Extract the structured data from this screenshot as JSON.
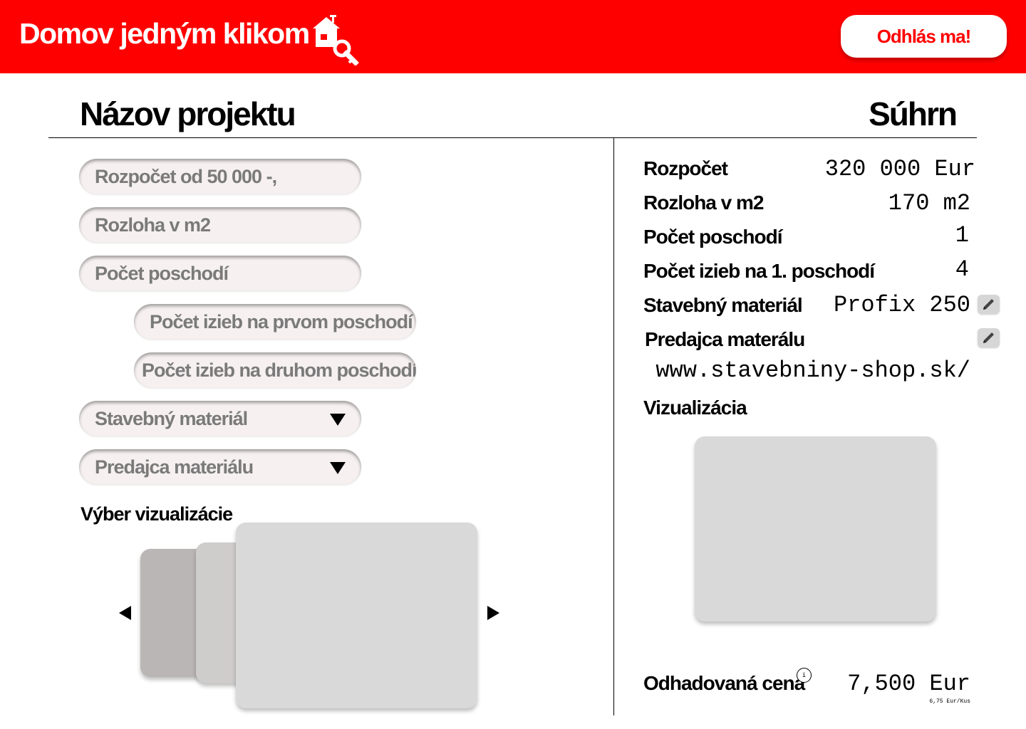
{
  "header": {
    "brand": "Domov jedným klikom",
    "brand_icon": "house-key-icon",
    "logout_label": "Odhlás ma!"
  },
  "colors": {
    "brand_red": "#ff0000",
    "field_bg": "#f6f0f0",
    "placeholder_gray": "#7a7a7a",
    "card_gray": "#d9d9d9",
    "card_back": "#bbb6b6"
  },
  "left": {
    "title": "Názov projektu",
    "fields": {
      "budget": "Rozpočet od 50 000 -,",
      "area": "Rozloha v m2",
      "floors": "Počet poschodí",
      "rooms_first": "Počet izieb na prvom poschodí",
      "rooms_second": "Počet izieb na druhom poschodí",
      "material": "Stavebný materiál",
      "seller": "Predajca materiálu"
    },
    "visualization_label": "Výber vizualizácie"
  },
  "summary": {
    "title": "Súhrn",
    "budget_label": "Rozpočet",
    "budget_value": "320 000 Eur",
    "area_label": "Rozloha v m2",
    "area_value": "170 m2",
    "floors_label": "Počet poschodí",
    "floors_value": "1",
    "rooms_label": "Počet izieb na 1. poschodí",
    "rooms_value": "4",
    "material_label": "Stavebný materiál",
    "material_value": "Profix 250",
    "seller_label": "Predajca materálu",
    "seller_value": "www.stavebniny-shop.sk/",
    "visualization_label": "Vizualizácia",
    "price_label": "Odhadovaná cena",
    "price_value": "7,500 Eur",
    "unit_price": "6,75 Eur/Kus",
    "info_glyph": "i"
  }
}
